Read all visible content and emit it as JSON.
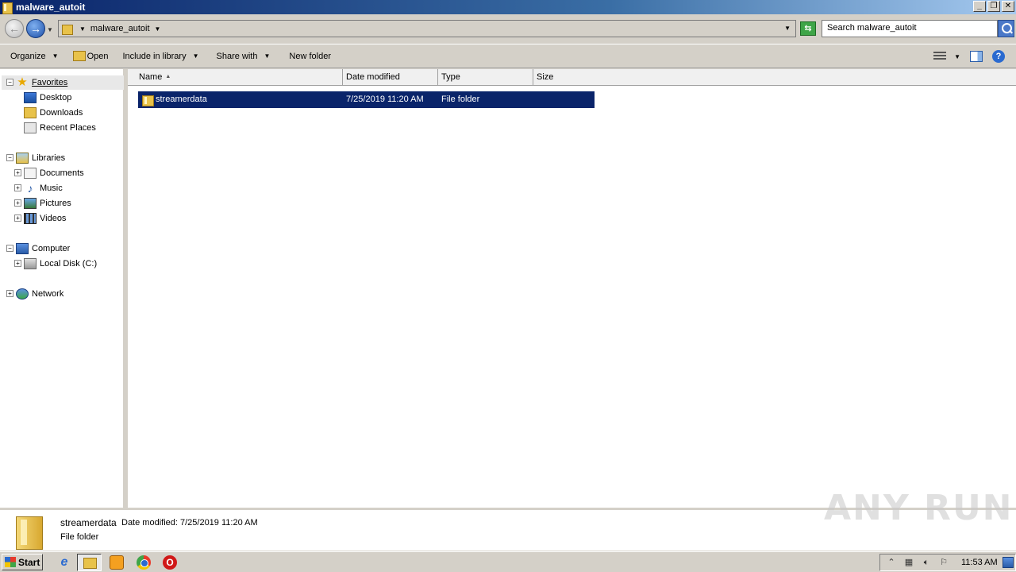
{
  "window": {
    "title": "malware_autoit",
    "min_glyph": "_",
    "restore_glyph": "❐",
    "close_glyph": "✕"
  },
  "address": {
    "crumb": "malware_autoit",
    "search_placeholder": "Search malware_autoit"
  },
  "toolbar": {
    "organize": "Organize",
    "open": "Open",
    "include_in_library": "Include in library",
    "share_with": "Share with",
    "new_folder": "New folder",
    "help": "?"
  },
  "nav": {
    "favorites": "Favorites",
    "desktop": "Desktop",
    "downloads": "Downloads",
    "recent_places": "Recent Places",
    "libraries": "Libraries",
    "documents": "Documents",
    "music": "Music",
    "pictures": "Pictures",
    "videos": "Videos",
    "computer": "Computer",
    "local_disk": "Local Disk (C:)",
    "network": "Network"
  },
  "columns": {
    "name": "Name",
    "date_modified": "Date modified",
    "type": "Type",
    "size": "Size"
  },
  "files": [
    {
      "name": "streamerdata",
      "date_modified": "7/25/2019 11:20 AM",
      "type": "File folder",
      "size": ""
    }
  ],
  "details": {
    "name": "streamerdata",
    "date_modified": "Date modified: 7/25/2019 11:20 AM",
    "type": "File folder"
  },
  "watermark": "ANY RUN",
  "taskbar": {
    "start": "Start",
    "clock": "11:53 AM"
  },
  "colors": {
    "selection": "#0a246a",
    "titlebar_start": "#0a246a",
    "titlebar_end": "#a6caf0",
    "folder": "#e8c24a"
  }
}
